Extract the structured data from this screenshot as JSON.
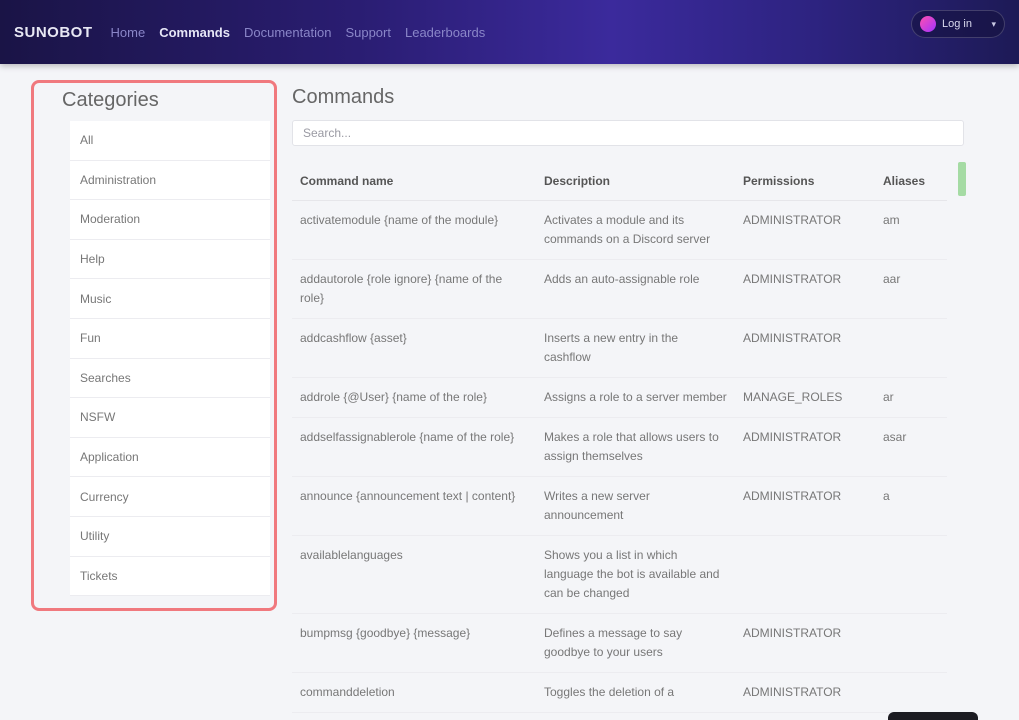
{
  "nav": {
    "brand": "SUNOBOT",
    "links": [
      {
        "label": "Home",
        "active": false
      },
      {
        "label": "Commands",
        "active": true
      },
      {
        "label": "Documentation",
        "active": false
      },
      {
        "label": "Support",
        "active": false
      },
      {
        "label": "Leaderboards",
        "active": false
      }
    ],
    "user": {
      "name": "Log in"
    }
  },
  "sidebar": {
    "title": "Categories",
    "items": [
      {
        "label": "All"
      },
      {
        "label": "Administration"
      },
      {
        "label": "Moderation"
      },
      {
        "label": "Help"
      },
      {
        "label": "Music"
      },
      {
        "label": "Fun"
      },
      {
        "label": "Searches"
      },
      {
        "label": "NSFW"
      },
      {
        "label": "Application"
      },
      {
        "label": "Currency"
      },
      {
        "label": "Utility"
      },
      {
        "label": "Tickets"
      }
    ]
  },
  "main": {
    "title": "Commands",
    "search_placeholder": "Search...",
    "columns": [
      "Command name",
      "Description",
      "Permissions",
      "Aliases"
    ],
    "rows": [
      {
        "name": "activatemodule {name of the module}",
        "desc": "Activates a module and its commands on a Discord server",
        "perm": "ADMINISTRATOR",
        "alias": "am"
      },
      {
        "name": "addautorole {role ignore} {name of the role}",
        "desc": "Adds an auto-assignable role",
        "perm": "ADMINISTRATOR",
        "alias": "aar"
      },
      {
        "name": "addcashflow {asset}",
        "desc": "Inserts a new entry in the cashflow",
        "perm": "ADMINISTRATOR",
        "alias": ""
      },
      {
        "name": "addrole {@User} {name of the role}",
        "desc": "Assigns a role to a server member",
        "perm": "MANAGE_ROLES",
        "alias": "ar"
      },
      {
        "name": "addselfassignablerole {name of the role}",
        "desc": "Makes a role that allows users to assign themselves",
        "perm": "ADMINISTRATOR",
        "alias": "asar"
      },
      {
        "name": "announce {announcement text | content}",
        "desc": "Writes a new server announcement",
        "perm": "ADMINISTRATOR",
        "alias": "a"
      },
      {
        "name": "availablelanguages",
        "desc": "Shows you a list in which language the bot is available and can be changed",
        "perm": "",
        "alias": ""
      },
      {
        "name": "bumpmsg {goodbye} {message}",
        "desc": "Defines a message to say goodbye to your users",
        "perm": "ADMINISTRATOR",
        "alias": ""
      },
      {
        "name": "commanddeletion",
        "desc": "Toggles the deletion of a",
        "perm": "ADMINISTRATOR",
        "alias": ""
      }
    ]
  },
  "colors": {
    "accent_border": "#f0797e",
    "nav_gradient_start": "#1a1446",
    "nav_gradient_mid": "#3b2a9c",
    "scroll_indicator": "#a5dba4"
  }
}
